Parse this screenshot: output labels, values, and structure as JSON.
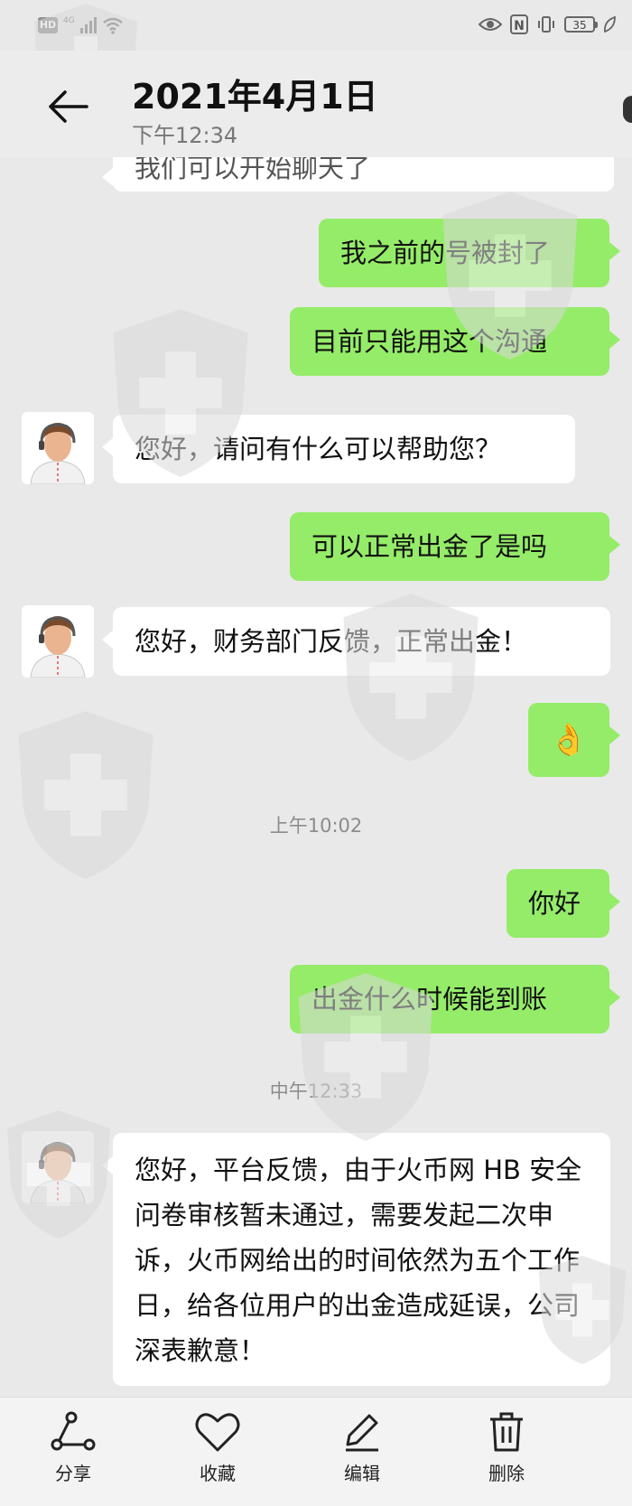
{
  "status_bar": {
    "hd_badge": "HD",
    "network": "4G",
    "battery": "35"
  },
  "header": {
    "title": "2021年4月1日",
    "subtitle": "下午12:34"
  },
  "messages": [
    {
      "side": "in",
      "text": "我们可以开始聊天了"
    },
    {
      "side": "out",
      "text": "我之前的号被封了"
    },
    {
      "side": "out",
      "text": "目前只能用这个沟通"
    },
    {
      "side": "in",
      "text": "您好，请问有什么可以帮助您？"
    },
    {
      "side": "out",
      "text": "可以正常出金了是吗"
    },
    {
      "side": "in",
      "text": "您好，财务部门反馈，正常出金！"
    },
    {
      "side": "out",
      "text": "👌"
    },
    {
      "side": "out",
      "text": "你好"
    },
    {
      "side": "out",
      "text": "出金什么时候能到账"
    },
    {
      "side": "in",
      "text": "您好，平台反馈，由于火币网 HB 安全问卷审核暂未通过，需要发起二次申诉，火币网给出的时间依然为五个工作日，给各位用户的出金造成延误，公司深表歉意！"
    }
  ],
  "timestamps": [
    "上午10:02",
    "中午12:33"
  ],
  "toolbar": {
    "share": "分享",
    "favorite": "收藏",
    "edit": "编辑",
    "delete": "删除"
  },
  "icons": {
    "back": "arrow-left-icon",
    "share": "share-icon",
    "favorite": "heart-icon",
    "edit": "pencil-icon",
    "delete": "trash-icon"
  },
  "colors": {
    "background": "#e9e9e9",
    "outgoing_bubble": "#95ec69",
    "incoming_bubble": "#ffffff",
    "timestamp": "#8c8c8c"
  }
}
